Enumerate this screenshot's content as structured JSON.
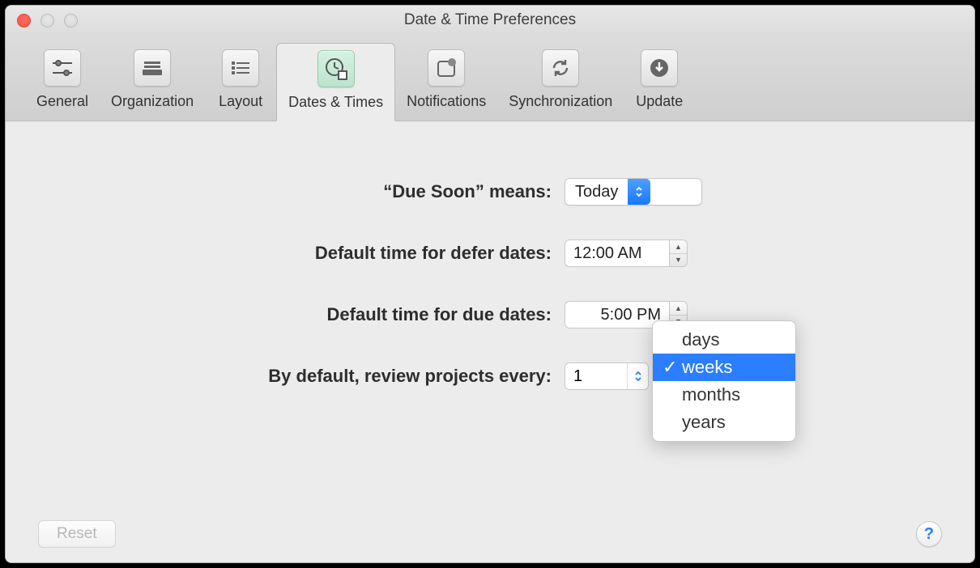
{
  "window": {
    "title": "Date & Time Preferences"
  },
  "tabs": [
    {
      "label": "General",
      "icon": "sliders"
    },
    {
      "label": "Organization",
      "icon": "stack"
    },
    {
      "label": "Layout",
      "icon": "list"
    },
    {
      "label": "Dates & Times",
      "icon": "clock"
    },
    {
      "label": "Notifications",
      "icon": "notify"
    },
    {
      "label": "Synchronization",
      "icon": "sync"
    },
    {
      "label": "Update",
      "icon": "download"
    }
  ],
  "form": {
    "due_soon_label": "“Due Soon” means:",
    "due_soon_value": "Today",
    "defer_label": "Default time for defer dates:",
    "defer_value": "12:00 AM",
    "due_label": "Default time for due dates:",
    "due_value": "5:00 PM",
    "review_label": "By default, review projects every:",
    "review_value": "1",
    "review_unit": "weeks"
  },
  "dropdown": {
    "options": [
      "days",
      "weeks",
      "months",
      "years"
    ],
    "selected": "weeks"
  },
  "footer": {
    "reset": "Reset",
    "help": "?"
  }
}
